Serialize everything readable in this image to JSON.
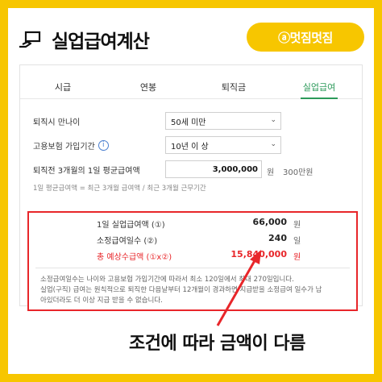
{
  "header": {
    "title": "실업급여계산",
    "icon": "hand-card-icon",
    "brand": "ⓐ멋짐멋짐"
  },
  "tabs": [
    {
      "label": "시급",
      "active": false
    },
    {
      "label": "연봉",
      "active": false
    },
    {
      "label": "퇴직금",
      "active": false
    },
    {
      "label": "실업급여",
      "active": true
    }
  ],
  "form": {
    "age": {
      "label": "퇴직시 만나이",
      "value": "50세 미만"
    },
    "period": {
      "label": "고용보험 가입기간",
      "value": "10년 이 상"
    },
    "wage": {
      "label": "퇴직전 3개월의 1일 평균급여액",
      "value": "3,000,000",
      "unit": "원",
      "hint_amount": "300만원"
    },
    "formula_hint": "1일 평균급여액 = 최근 3개월 급여액 / 최근 3개월 근무기간"
  },
  "results": {
    "daily": {
      "label": "1일 실업급여액 (①)",
      "value": "66,000",
      "unit": "원"
    },
    "days": {
      "label": "소정급여일수 (②)",
      "value": "240",
      "unit": "일"
    },
    "total": {
      "label": "총 예상수급액 (①x②)",
      "value": "15,840,000",
      "unit": "원"
    }
  },
  "notes": [
    "소정급여일수는 나이와 고용보험 가입기간에 따라서 최소 120일에서 최대 270일입니다.",
    "실업(구직) 급여는 원칙적으로 퇴직한 다음날부터 12개월이 경과하면 지급받을 소정급여 일수가 남",
    "아있더라도 더 이상 지급 받을 수 없습니다."
  ],
  "caption": "조건에 따라 금액이 다름",
  "colors": {
    "accent": "#2c9a5a",
    "highlight": "#e8262a",
    "brand": "#f7c600"
  }
}
